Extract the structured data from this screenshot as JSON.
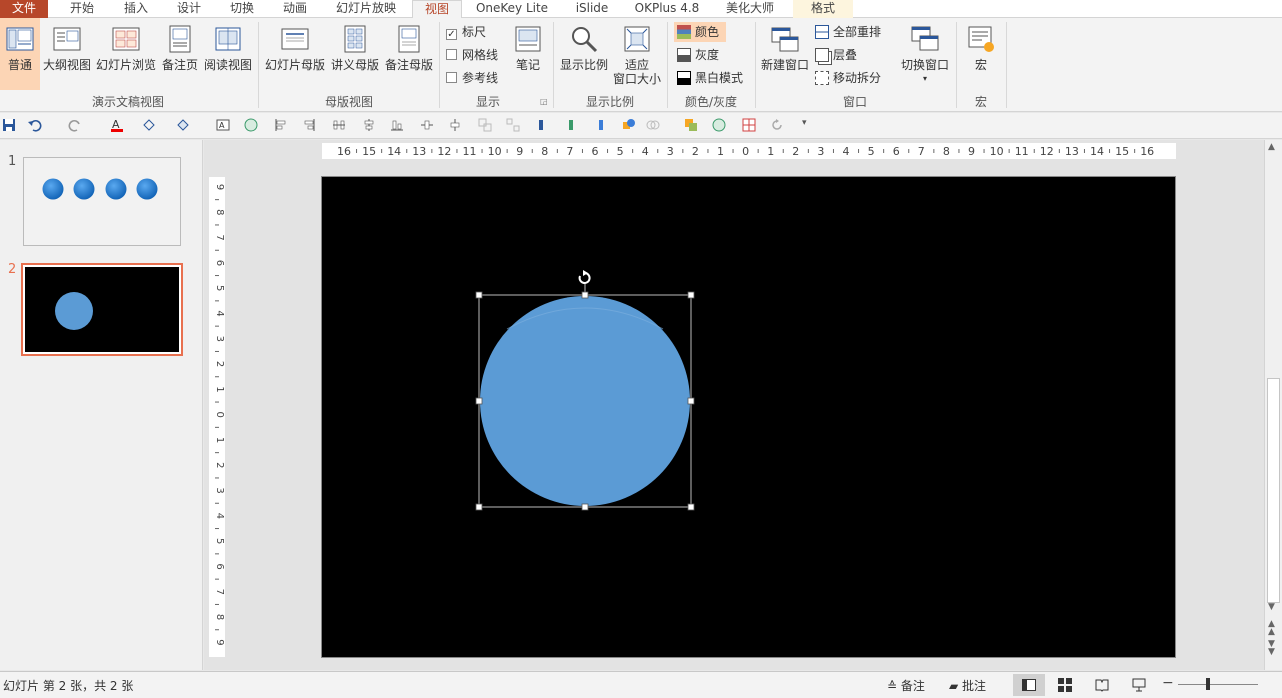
{
  "tabs": [
    "文件",
    "开始",
    "插入",
    "设计",
    "切换",
    "动画",
    "幻灯片放映",
    "视图",
    "OneKey Lite",
    "iSlide",
    "OKPlus 4.8",
    "美化大师",
    "格式"
  ],
  "ribbon": {
    "views": {
      "normal": "普通",
      "outline": "大纲视图",
      "sorter": "幻灯片浏览",
      "notes_page": "备注页",
      "reading": "阅读视图",
      "group": "演示文稿视图"
    },
    "masters": {
      "slide_master": "幻灯片母版",
      "handout_master": "讲义母版",
      "notes_master": "备注母版",
      "group": "母版视图"
    },
    "show": {
      "ruler": "标尺",
      "gridlines": "网格线",
      "guides": "参考线",
      "notes": "笔记",
      "group": "显示"
    },
    "zoom": {
      "zoom": "显示比例",
      "fit_line1": "适应",
      "fit_line2": "窗口大小",
      "group": "显示比例"
    },
    "color": {
      "color": "颜色",
      "grayscale": "灰度",
      "bw": "黑白模式",
      "group": "颜色/灰度"
    },
    "window": {
      "new_window": "新建窗口",
      "arrange_all": "全部重排",
      "cascade": "层叠",
      "move_split": "移动拆分",
      "switch": "切换窗口",
      "group": "窗口"
    },
    "macros": {
      "macro": "宏",
      "group": "宏"
    }
  },
  "thumbnails": [
    {
      "number": "1"
    },
    {
      "number": "2"
    }
  ],
  "ruler_h": [
    "16",
    "15",
    "14",
    "13",
    "12",
    "11",
    "10",
    "9",
    "8",
    "7",
    "6",
    "5",
    "4",
    "3",
    "2",
    "1",
    "0",
    "1",
    "2",
    "3",
    "4",
    "5",
    "6",
    "7",
    "8",
    "9",
    "10",
    "11",
    "12",
    "13",
    "14",
    "15",
    "16"
  ],
  "ruler_v": [
    "9",
    "8",
    "7",
    "6",
    "5",
    "4",
    "3",
    "2",
    "1",
    "0",
    "1",
    "2",
    "3",
    "4",
    "5",
    "6",
    "7",
    "8",
    "9"
  ],
  "status": {
    "slide_info": "幻灯片 第 2 张，共 2 张",
    "notes": "备注",
    "comments": "批注"
  },
  "colors": {
    "accent": "#b7472a",
    "circle": "#5b9bd5",
    "selected_thumb": "#e8704f"
  }
}
